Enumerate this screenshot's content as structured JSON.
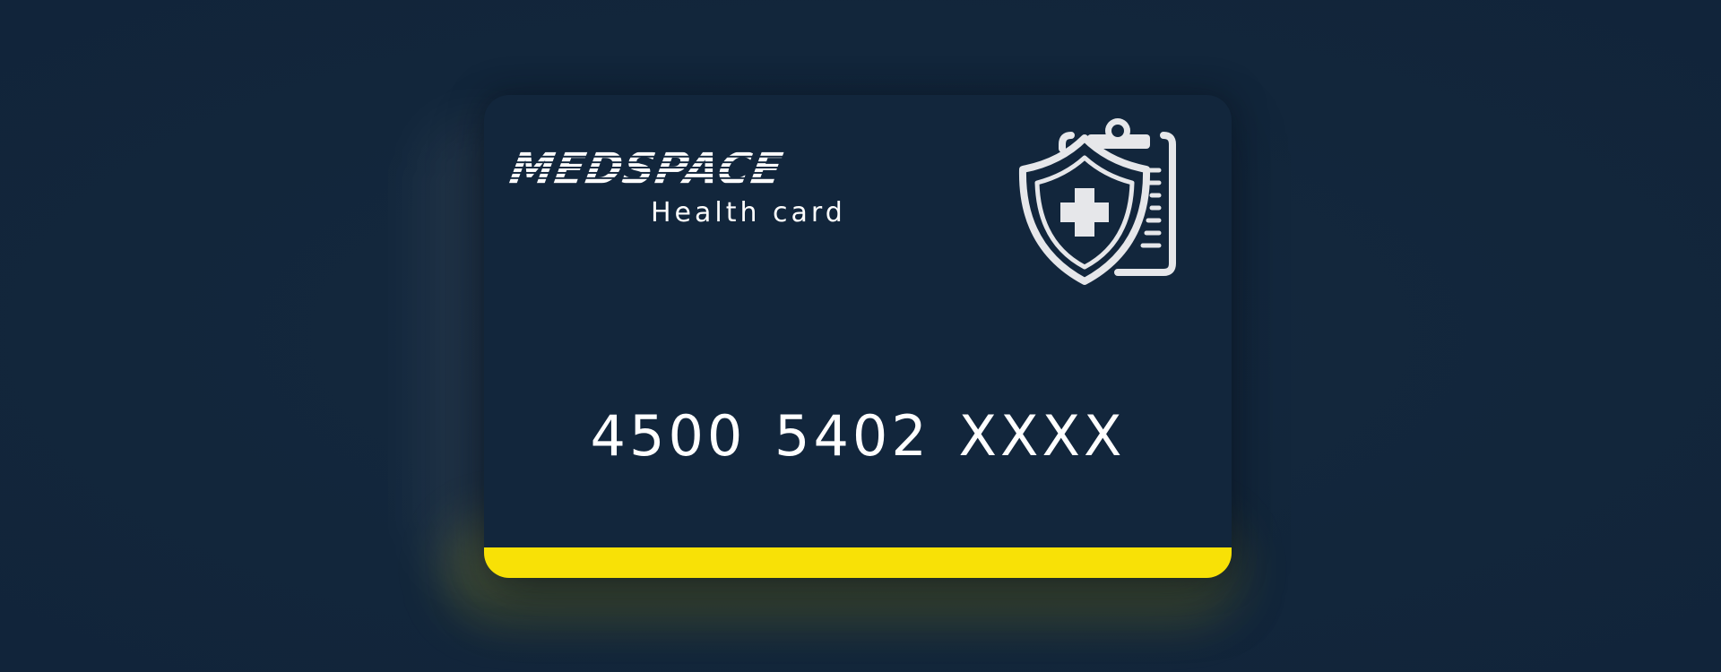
{
  "card": {
    "brand": "MEDSPACE",
    "subtitle": "Health card",
    "number": "4500 5402 XXXX",
    "emblem_icon": "medical-shield-clipboard-icon"
  },
  "colors": {
    "background": "#13273d",
    "card": "#12263c",
    "stripe": "#f8e106",
    "text": "#ffffff",
    "icon": "#e6e7ea"
  }
}
